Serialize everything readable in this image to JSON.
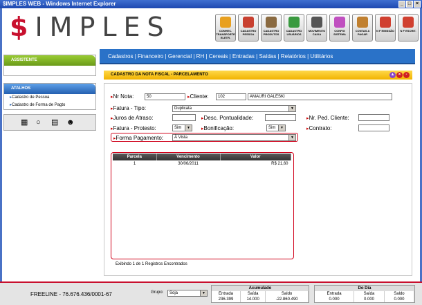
{
  "window": {
    "title": "$IMPLES WEB - Windows Internet Explorer"
  },
  "logo": {
    "s": "$",
    "rest": "IMPLES"
  },
  "toolbar": [
    {
      "label": "CONHEC. TRANSPORTE ELETR.",
      "color": "#e8a020"
    },
    {
      "label": "CADASTRO PESSOA",
      "color": "#c84030"
    },
    {
      "label": "CADASTRO PRODUTOS",
      "color": "#8a6a40"
    },
    {
      "label": "CADASTRO USUÁRIOS",
      "color": "#3a9a40"
    },
    {
      "label": "MOVIMENTO CAIXA",
      "color": "#555555"
    },
    {
      "label": "CONFIG SISTEMA",
      "color": "#c050c0"
    },
    {
      "label": "CONTAS A PAGAR",
      "color": "#c08030"
    },
    {
      "label": "N F EMISSÃO",
      "color": "#d04030"
    },
    {
      "label": "N F ESCRIT.",
      "color": "#d04030"
    }
  ],
  "nav": {
    "items": [
      "Cadastros",
      "Financeiro",
      "Gerencial",
      "RH",
      "Cereais",
      "Entradas",
      "Saídas",
      "Relatórios",
      "Utilitários"
    ]
  },
  "sidebar": {
    "assistente": "ASSISTENTE",
    "atalhos": "ATALHOS",
    "links": [
      "Cadastro de Pessoa",
      "Cadastro de Forma de Pagto"
    ]
  },
  "form": {
    "title": "CADASTRO DA NOTA FISCAL - PARCELAMENTO",
    "nr_nota_label": "Nr Nota:",
    "nr_nota": "50",
    "cliente_label": "Cliente:",
    "cliente_code": "102",
    "cliente_name": "AMAURI GALESKI",
    "fatura_tipo_label": "Fatura - Tipo:",
    "fatura_tipo": "Duplicata",
    "juros_label": "Juros de Atraso:",
    "desc_label": "Desc. Pontualidade:",
    "nr_ped_label": "Nr. Ped. Cliente:",
    "protesto_label": "Fatura - Protesto:",
    "protesto": "Sim",
    "bonificacao_label": "Bonificação:",
    "bonificacao": "Sim",
    "contrato_label": "Contrato:",
    "forma_label": "Forma Pagamento:",
    "forma": "À Vista"
  },
  "grid": {
    "headers": [
      "Parcela",
      "Vencimento",
      "Valor"
    ],
    "rows": [
      {
        "parcela": "1",
        "vencimento": "30/06/2011",
        "valor": "R$ 21,60"
      }
    ]
  },
  "records": "Exibindo 1 de 1 Registros Encontrados",
  "footer": {
    "freeline": "FREELINE - 76.676.436/0001-67",
    "grupo_label": "Grupo:",
    "grupo": "Soja",
    "acumulado": {
      "title": "Acumulado",
      "headers": [
        "Entrada",
        "Saída",
        "Saldo"
      ],
      "values": [
        "236.399",
        "14.000",
        "-22.860.490"
      ]
    },
    "dia": {
      "title": "Do Dia",
      "headers": [
        "Entrada",
        "Saída",
        "Saldo"
      ],
      "values": [
        "0.000",
        "0.000",
        "0.000"
      ]
    }
  }
}
